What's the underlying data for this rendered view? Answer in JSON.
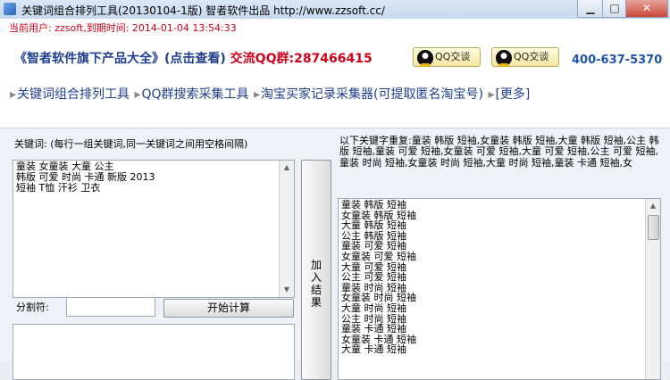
{
  "window": {
    "title": "关键词组合排列工具(20130104-1版) 智者软件出品 http://www.zzsoft.cc/",
    "buttons": {
      "minimize": "▁",
      "maximize": "□",
      "close": "✕"
    }
  },
  "header": {
    "user_line": "当前用户: zzsoft,到期时间: 2014-01-04 13:54:33",
    "promo_products": "《智者软件旗下产品大全》(点击查看)",
    "promo_qq_label": "交流QQ群:",
    "promo_qq_number": "287466415",
    "qq_button_1": "QQ交谈",
    "qq_button_2": "QQ交谈",
    "phone": "400-637-5370"
  },
  "nav": {
    "items": [
      "关键词组合排列工具",
      "QQ群搜索采集工具",
      "淘宝买家记录采集器(可提取匿名淘宝号)",
      "[更多]"
    ]
  },
  "left": {
    "keyword_label": "关键词: (每行一组关键词,同一关键词之间用空格间隔)",
    "keyword_text": "童装 女童装 大童 公主\n韩版 可爱 时尚 卡通 新版 2013\n短袖 T恤 汗衫 卫衣",
    "separator_label": "分割符:",
    "separator_value": "",
    "calc_button": "开始计算"
  },
  "middle": {
    "add_button": "加\n入\n结\n果"
  },
  "right": {
    "duplicate_text": "以下关键字重复:童装 韩版 短袖,女童装 韩版 短袖,大童 韩版 短袖,公主 韩版 短袖,童装 可爱 短袖,女童装 可爱 短袖,大童 可爱 短袖,公主 可爱 短袖,童装 时尚 短袖,女童装 时尚 短袖,大童 时尚 短袖,童装 卡通 短袖,女",
    "results": "童装 韩版 短袖\n女童装 韩版 短袖\n大童 韩版 短袖\n公主 韩版 短袖\n童装 可爱 短袖\n女童装 可爱 短袖\n大童 可爱 短袖\n公主 可爱 短袖\n童装 时尚 短袖\n女童装 时尚 短袖\n大童 时尚 短袖\n公主 时尚 短袖\n童装 卡通 短袖\n女童装 卡通 短袖\n大童 卡通 短袖"
  }
}
